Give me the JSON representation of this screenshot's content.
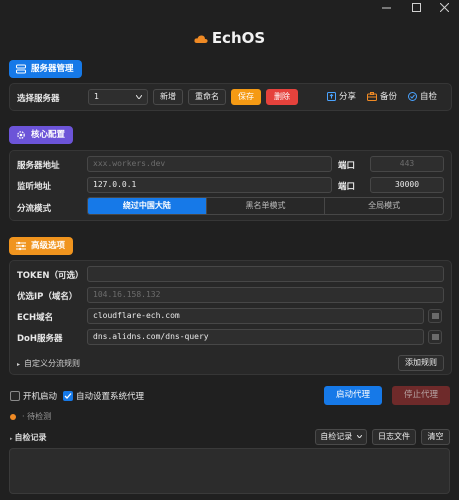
{
  "window": {
    "min_icon": "minimize-icon",
    "max_icon": "maximize-icon",
    "close_icon": "close-icon"
  },
  "app": {
    "title": "EchOS",
    "logo_icon": "cloud-icon",
    "logo_color": "#f08a24"
  },
  "server_section": {
    "title": "服务器管理",
    "color": "#1679e8",
    "select_label": "选择服务器",
    "select_value": "1",
    "add_label": "新增",
    "rename_label": "重命名",
    "save_label": "保存",
    "delete_label": "删除",
    "share_label": "分享",
    "backup_label": "备份",
    "selfcheck_label": "自检"
  },
  "core_section": {
    "title": "核心配置",
    "color": "#6c54d8",
    "server_addr_label": "服务器地址",
    "server_addr_placeholder": "xxx.workers.dev",
    "port_label": "端口",
    "port_placeholder": "443",
    "listen_label": "监听地址",
    "listen_value": "127.0.0.1",
    "listen_port_label": "端口",
    "listen_port_value": "30000",
    "routing_label": "分流模式",
    "routing_options": [
      "绕过中国大陆",
      "黑名单模式",
      "全局模式"
    ],
    "routing_selected": "绕过中国大陆"
  },
  "advanced_section": {
    "title": "高级选项",
    "color": "#f0941e",
    "token_label": "TOKEN（可选）",
    "token_value": "",
    "preferred_ip_label": "优选IP（域名）",
    "preferred_ip_placeholder": "104.16.158.132",
    "ech_label": "ECH域名",
    "ech_value": "cloudflare-ech.com",
    "doh_label": "DoH服务器",
    "doh_value": "dns.alidns.com/dns-query",
    "custom_rules_label": "自定义分流规则",
    "add_rule_label": "添加规则"
  },
  "bottom": {
    "autostart_label": "开机启动",
    "autostart_checked": false,
    "auto_proxy_label": "自动设置系统代理",
    "auto_proxy_checked": true,
    "start_label": "启动代理",
    "stop_label": "停止代理",
    "status_text": "待检测",
    "status_color": "#f08a24",
    "log_title": "自检记录",
    "log_select": "自检记录",
    "log_file_label": "日志文件",
    "clear_label": "清空"
  }
}
